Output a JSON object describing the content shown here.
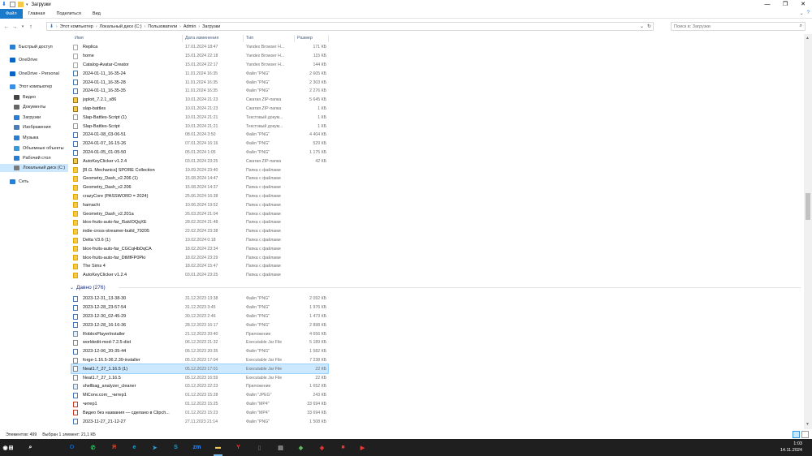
{
  "window": {
    "title": "Загрузки",
    "controls": [
      "—",
      "❐",
      "✕"
    ]
  },
  "ribbon": {
    "tabs": [
      "Файл",
      "Главная",
      "Поделиться",
      "Вид"
    ]
  },
  "address": {
    "breadcrumbs": [
      "Этот компьютер",
      "Локальный диск (C:)",
      "Пользователи",
      "Admin",
      "Загрузки"
    ]
  },
  "search": {
    "placeholder": "Поиск в: Загрузки"
  },
  "nav": {
    "items": [
      {
        "label": "Быстрый доступ",
        "icon": "star-icon",
        "color": "#2b7cd3"
      },
      {
        "label": "OneDrive",
        "icon": "cloud-icon",
        "color": "#0a64c8"
      },
      {
        "label": "OneDrive - Personal",
        "icon": "cloud-icon",
        "color": "#0a64c8"
      },
      {
        "label": "Этот компьютер",
        "icon": "computer-icon",
        "color": "#3a8ee6"
      },
      {
        "label": "Видео",
        "icon": "video-icon",
        "color": "#444"
      },
      {
        "label": "Документы",
        "icon": "documents-icon",
        "color": "#666"
      },
      {
        "label": "Загрузки",
        "icon": "download-icon",
        "color": "#2b7cd3"
      },
      {
        "label": "Изображения",
        "icon": "pictures-icon",
        "color": "#4a7fb5"
      },
      {
        "label": "Музыка",
        "icon": "music-icon",
        "color": "#2b7cd3"
      },
      {
        "label": "Объемные объекты",
        "icon": "3d-objects-icon",
        "color": "#3a9ad9"
      },
      {
        "label": "Рабочий стол",
        "icon": "desktop-icon",
        "color": "#2b7cd3"
      },
      {
        "label": "Локальный диск (C:)",
        "icon": "drive-icon",
        "color": "#7a7a7a"
      },
      {
        "label": "Сеть",
        "icon": "network-icon",
        "color": "#2b7cd3"
      }
    ]
  },
  "columns": {
    "name": "Имя",
    "date": "Дата изменения",
    "type": "Тип",
    "size": "Размер"
  },
  "files_recent": [
    {
      "name": "Replica",
      "date": "17.01.2024 18:47",
      "type": "Yandex Browser H...",
      "size": "171 КБ",
      "kind": "html"
    },
    {
      "name": "home",
      "date": "15.01.2024 22:18",
      "type": "Yandex Browser H...",
      "size": "115 КБ",
      "kind": "html"
    },
    {
      "name": "Catalog-Avatar-Creator",
      "date": "15.01.2024 22:17",
      "type": "Yandex Browser H...",
      "size": "144 КБ",
      "kind": "html"
    },
    {
      "name": "2024-01-11_16-35-24",
      "date": "11.01.2024 16:35",
      "type": "Файл \"PNG\"",
      "size": "2 605 КБ",
      "kind": "png"
    },
    {
      "name": "2024-01-11_16-35-28",
      "date": "11.01.2024 16:35",
      "type": "Файл \"PNG\"",
      "size": "2 303 КБ",
      "kind": "png"
    },
    {
      "name": "2024-01-11_16-35-35",
      "date": "11.01.2024 16:35",
      "type": "Файл \"PNG\"",
      "size": "2 276 КБ",
      "kind": "png"
    },
    {
      "name": "jsploit_7.2.1_x86",
      "date": "10.01.2024 21:23",
      "type": "Сжатая ZIP-папка",
      "size": "5 645 КБ",
      "kind": "zip"
    },
    {
      "name": "slap-battles",
      "date": "10.01.2024 21:23",
      "type": "Сжатая ZIP-папка",
      "size": "1 КБ",
      "kind": "zip"
    },
    {
      "name": "Slap-Battles-Script (1)",
      "date": "10.01.2024 21:21",
      "type": "Текстовый докум...",
      "size": "1 КБ",
      "kind": "txt"
    },
    {
      "name": "Slap-Battles-Script",
      "date": "10.01.2024 21:21",
      "type": "Текстовый докум...",
      "size": "1 КБ",
      "kind": "txt"
    },
    {
      "name": "2024-01-08_03-06-51",
      "date": "08.01.2024 3:50",
      "type": "Файл \"PNG\"",
      "size": "4 404 КБ",
      "kind": "png"
    },
    {
      "name": "2024-01-07_16-15-26",
      "date": "07.01.2024 16:16",
      "type": "Файл \"PNG\"",
      "size": "529 КБ",
      "kind": "png"
    },
    {
      "name": "2024-01-05_01-05-50",
      "date": "05.01.2024 1:05",
      "type": "Файл \"PNG\"",
      "size": "1 175 КБ",
      "kind": "png"
    },
    {
      "name": "AutoKeyClicker v1.2.4",
      "date": "03.01.2024 23:25",
      "type": "Сжатая ZIP-папка",
      "size": "42 КБ",
      "kind": "zip"
    },
    {
      "name": "[R.G. Mechanics] SPORE Collection",
      "date": "19.09.2024 23:40",
      "type": "Папка с файлами",
      "size": "",
      "kind": "folder"
    },
    {
      "name": "Geometry_Dash_v2.206 (1)",
      "date": "15.08.2024 14:47",
      "type": "Папка с файлами",
      "size": "",
      "kind": "folder"
    },
    {
      "name": "Geometry_Dash_v2.206",
      "date": "15.08.2024 14:37",
      "type": "Папка с файлами",
      "size": "",
      "kind": "folder"
    },
    {
      "name": "crazyCore (PASSWORD = 2024)",
      "date": "25.06.2024 16:38",
      "type": "Папка с файлами",
      "size": "",
      "kind": "folder"
    },
    {
      "name": "hamachi",
      "date": "10.06.2024 19:52",
      "type": "Папка с файлами",
      "size": "",
      "kind": "folder"
    },
    {
      "name": "Geometry_Dash_v2.201a",
      "date": "26.03.2024 21:04",
      "type": "Папка с файлами",
      "size": "",
      "kind": "folder"
    },
    {
      "name": "blox-fruits-auto-far_I5akIOQqXE",
      "date": "28.02.2024 21:48",
      "type": "Папка с файлами",
      "size": "",
      "kind": "folder"
    },
    {
      "name": "indie-cross-streamer-build_79205",
      "date": "22.02.2024 23:38",
      "type": "Папка с файлами",
      "size": "",
      "kind": "folder"
    },
    {
      "name": "Delta V3.6 (1)",
      "date": "19.02.2024 0:18",
      "type": "Папка с файлами",
      "size": "",
      "kind": "folder"
    },
    {
      "name": "blox-fruits-auto-far_CGCqHbDqCA",
      "date": "18.02.2024 23:34",
      "type": "Папка с файлами",
      "size": "",
      "kind": "folder"
    },
    {
      "name": "blox-fruits-auto-far_DtMfFP0Pki",
      "date": "18.02.2024 23:29",
      "type": "Папка с файлами",
      "size": "",
      "kind": "folder"
    },
    {
      "name": "The Sims 4",
      "date": "18.02.2024 15:47",
      "type": "Папка с файлами",
      "size": "",
      "kind": "folder"
    },
    {
      "name": "AutoKeyClicker v1.2.4",
      "date": "03.01.2024 23:25",
      "type": "Папка с файлами",
      "size": "",
      "kind": "folder"
    }
  ],
  "group_old": {
    "label": "Давно (276)"
  },
  "files_old": [
    {
      "name": "2023-12-31_13-38-30",
      "date": "31.12.2023 13:38",
      "type": "Файл \"PNG\"",
      "size": "2 092 КБ",
      "kind": "png"
    },
    {
      "name": "2023-12-28_23-57-54",
      "date": "31.12.2023 3:45",
      "type": "Файл \"PNG\"",
      "size": "1 976 КБ",
      "kind": "png"
    },
    {
      "name": "2023-12-30_02-45-29",
      "date": "30.12.2023 2:46",
      "type": "Файл \"PNG\"",
      "size": "1 473 КБ",
      "kind": "png"
    },
    {
      "name": "2023-12-28_16-16-36",
      "date": "28.12.2023 16:17",
      "type": "Файл \"PNG\"",
      "size": "2 898 КБ",
      "kind": "png"
    },
    {
      "name": "RobloxPlayerInstaller",
      "date": "21.12.2023 20:40",
      "type": "Приложение",
      "size": "4 656 КБ",
      "kind": "exe"
    },
    {
      "name": "worldedit-mod-7.2.5-dist",
      "date": "06.12.2023 21:32",
      "type": "Executable Jar File",
      "size": "5 189 КБ",
      "kind": "jar"
    },
    {
      "name": "2023-12-06_20-35-44",
      "date": "06.12.2023 20:35",
      "type": "Файл \"PNG\"",
      "size": "1 582 КБ",
      "kind": "png"
    },
    {
      "name": "forge-1.16.5-36.2.39-installer",
      "date": "05.12.2023 17:04",
      "type": "Executable Jar File",
      "size": "7 238 КБ",
      "kind": "jar"
    },
    {
      "name": "Neat1.7_27_1.16.5 (1)",
      "date": "05.12.2023 17:01",
      "type": "Executable Jar File",
      "size": "22 КБ",
      "kind": "jar",
      "selected": true
    },
    {
      "name": "Neat1.7_27_1.16.5",
      "date": "05.12.2023 16:59",
      "type": "Executable Jar File",
      "size": "22 КБ",
      "kind": "jar"
    },
    {
      "name": "shellbag_analyzer_cleaner",
      "date": "03.12.2023 22:23",
      "type": "Приложение",
      "size": "1 652 КБ",
      "kind": "exe"
    },
    {
      "name": "MiConv.com__читер1",
      "date": "01.12.2023 15:28",
      "type": "Файл \"JPEG\"",
      "size": "243 КБ",
      "kind": "png"
    },
    {
      "name": "читер1",
      "date": "01.12.2023 15:25",
      "type": "Файл \"MP4\"",
      "size": "33 694 КБ",
      "kind": "mp4"
    },
    {
      "name": "Видео без названия — сделано в Clipch...",
      "date": "01.12.2023 15:23",
      "type": "Файл \"MP4\"",
      "size": "33 694 КБ",
      "kind": "mp4"
    },
    {
      "name": "2023-11-27_21-12-27",
      "date": "27.11.2023 21:14",
      "type": "Файл \"PNG\"",
      "size": "1 508 КБ",
      "kind": "png"
    }
  ],
  "status": {
    "count": "Элементов: 499",
    "selection": "Выбран 1 элемент: 21,1 КБ"
  },
  "taskbar": {
    "apps": [
      {
        "icon": "windows-start-icon",
        "glyph": "⊞",
        "color": "#ffffff"
      },
      {
        "icon": "search-icon",
        "glyph": "⌕",
        "color": "#ffffff"
      },
      {
        "icon": "outlook-icon",
        "glyph": "O",
        "color": "#0a64c8"
      },
      {
        "icon": "whatsapp-icon",
        "glyph": "✆",
        "color": "#25d366"
      },
      {
        "icon": "yandex-icon",
        "glyph": "Я",
        "color": "#fc3f1d"
      },
      {
        "icon": "edge-icon",
        "glyph": "e",
        "color": "#1fa4d6"
      },
      {
        "icon": "telegram-icon",
        "glyph": "➤",
        "color": "#2aa3e0"
      },
      {
        "icon": "roblox-icon",
        "glyph": "▢",
        "color": "#cccccc"
      },
      {
        "icon": "skype-icon",
        "glyph": "S",
        "color": "#00aff0"
      },
      {
        "icon": "zoom-icon",
        "glyph": "zm",
        "color": "#2d8cff"
      },
      {
        "icon": "file-explorer-icon",
        "glyph": "▬",
        "color": "#f7c948"
      },
      {
        "icon": "yandex-browser-icon",
        "glyph": "Y",
        "color": "#ff3333"
      },
      {
        "icon": "app-icon-dark",
        "glyph": "▯",
        "color": "#555555"
      },
      {
        "icon": "app-icon-gray",
        "glyph": "▤",
        "color": "#aaaaaa"
      },
      {
        "icon": "minecraft-icon",
        "glyph": "◆",
        "color": "#5cb85c"
      },
      {
        "icon": "anydesk-icon",
        "glyph": "◈",
        "color": "#e53935"
      },
      {
        "icon": "media-app-icon",
        "glyph": "■",
        "color": "#e53935"
      },
      {
        "icon": "video-app-icon",
        "glyph": "▶",
        "color": "#e53935"
      },
      {
        "icon": "player-icon",
        "glyph": "◉",
        "color": "#ffffff"
      }
    ],
    "clock_time": "1:03",
    "clock_date": "14.11.2024"
  }
}
